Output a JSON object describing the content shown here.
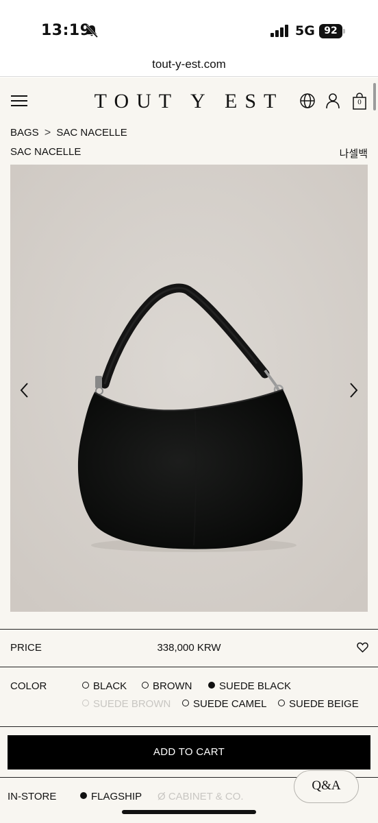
{
  "status_bar": {
    "time": "13:19",
    "network": "5G",
    "battery": "92"
  },
  "browser": {
    "url": "tout-y-est.com"
  },
  "header": {
    "logo": "TOUT Y EST",
    "cart_count": "0"
  },
  "breadcrumb": {
    "items": [
      "BAGS",
      "SAC NACELLE"
    ],
    "separator": ">"
  },
  "product": {
    "title": "SAC NACELLE",
    "title_kr": "나셀백",
    "price_label": "PRICE",
    "price": "338,000 KRW",
    "color_label": "COLOR",
    "colors": [
      {
        "label": "BLACK",
        "state": "available"
      },
      {
        "label": "BROWN",
        "state": "available"
      },
      {
        "label": "SUEDE BLACK",
        "state": "selected"
      },
      {
        "label": "SUEDE BROWN",
        "state": "disabled"
      },
      {
        "label": "SUEDE CAMEL",
        "state": "available"
      },
      {
        "label": "SUEDE BEIGE",
        "state": "available"
      }
    ],
    "add_to_cart": "ADD TO CART",
    "instore_label": "IN-STORE",
    "stores": [
      {
        "label": "FLAGSHIP",
        "state": "available"
      },
      {
        "label": "CABINET & CO.",
        "state": "unavailable",
        "prefix": "Ø"
      }
    ]
  },
  "qa_button": "Q&A",
  "icons": {
    "menu": "hamburger-menu-icon",
    "globe": "globe-icon",
    "account": "user-icon",
    "cart": "shopping-bag-icon",
    "wishlist": "heart-icon",
    "prev": "chevron-left-icon",
    "next": "chevron-right-icon"
  },
  "colors": {
    "background": "#f8f6f1",
    "photo_background": "#d9d4cf",
    "button": "#000000",
    "disabled_text": "#c8c6c2"
  }
}
